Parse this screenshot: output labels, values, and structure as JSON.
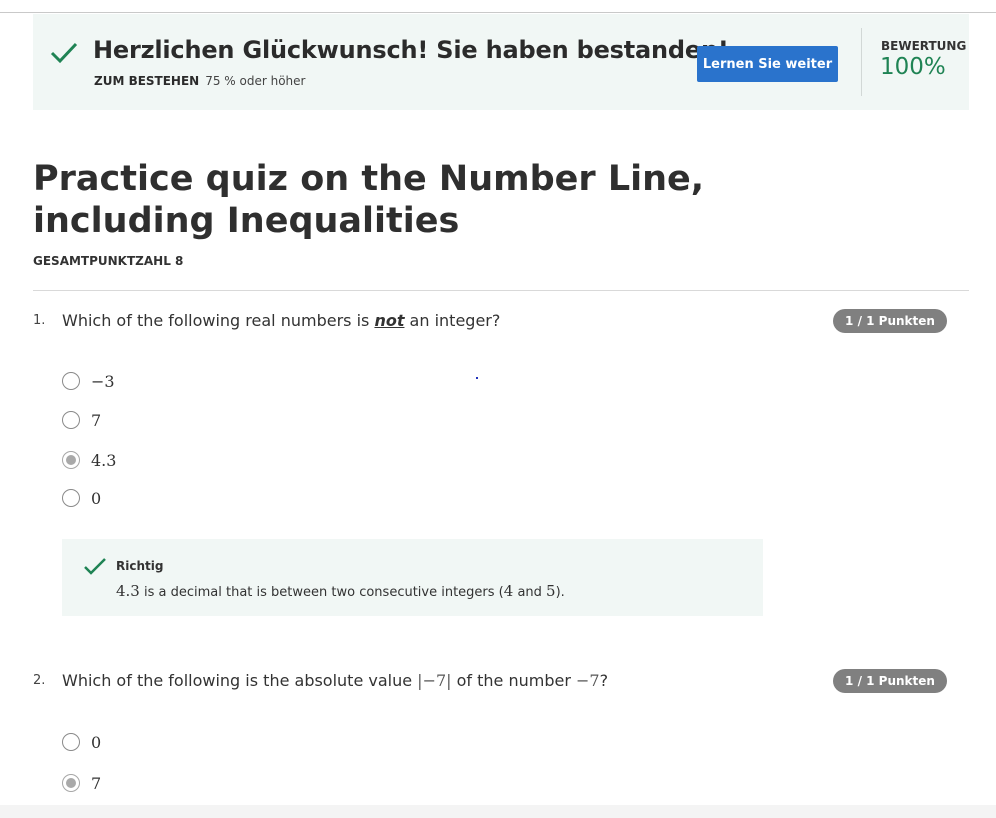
{
  "banner": {
    "title": "Herzlichen Glückwunsch! Sie haben bestanden!",
    "pass_label": "ZUM BESTEHEN",
    "pass_value": "75 % oder höher",
    "continue_label": "Lernen Sie weiter",
    "grade_label": "BEWERTUNG",
    "grade_value": "100%"
  },
  "quiz": {
    "title": "Practice quiz on the Number Line, including Inequalities",
    "total_points": "GESAMTPUNKTZAHL 8"
  },
  "questions": [
    {
      "number": "1.",
      "text_before": "Which of the following real numbers is ",
      "text_emph": "not",
      "text_after": " an integer?",
      "points": "1 / 1 Punkten",
      "options": [
        {
          "label": "−3",
          "selected": false
        },
        {
          "label": "7",
          "selected": false
        },
        {
          "label": "4.3",
          "selected": true
        },
        {
          "label": "0",
          "selected": false
        }
      ],
      "feedback": {
        "title": "Richtig",
        "value": "4.3",
        "text_mid": " is a decimal that is between two consecutive integers (",
        "num_a": "4",
        "text_and": " and ",
        "num_b": "5",
        "text_end": ")."
      }
    },
    {
      "number": "2.",
      "text_before": "Which of the following is the absolute value ",
      "math_abs": "|−7|",
      "text_mid": " of the number ",
      "math_num": "−7",
      "text_after": "?",
      "points": "1 / 1 Punkten",
      "options": [
        {
          "label": "0",
          "selected": false
        },
        {
          "label": "7",
          "selected": true
        }
      ]
    }
  ],
  "colors": {
    "accent_green": "#1f8354",
    "button_blue": "#2a73cc",
    "banner_bg": "#f1f7f5",
    "pill_gray": "#808080"
  },
  "icons": {
    "banner": "checkmark-icon",
    "feedback": "checkmark-icon"
  }
}
